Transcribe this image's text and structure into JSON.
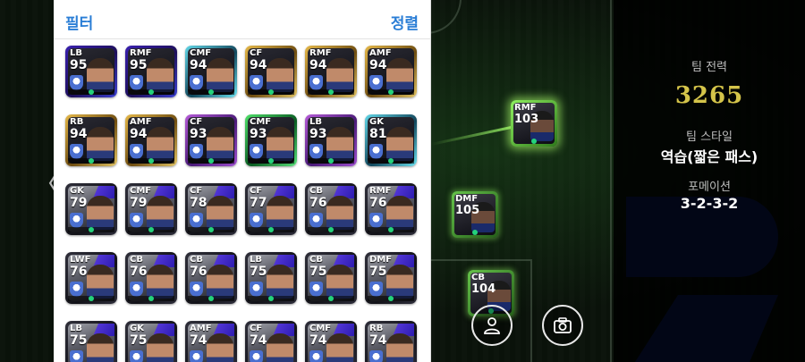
{
  "panel": {
    "filter_label": "필터",
    "sort_label": "정렬",
    "cards": [
      {
        "pos": "LB",
        "ovr": "95",
        "tier": "blue"
      },
      {
        "pos": "RMF",
        "ovr": "95",
        "tier": "blue"
      },
      {
        "pos": "CMF",
        "ovr": "94",
        "tier": "teal"
      },
      {
        "pos": "CF",
        "ovr": "94",
        "tier": "gold"
      },
      {
        "pos": "RMF",
        "ovr": "94",
        "tier": "gold"
      },
      {
        "pos": "AMF",
        "ovr": "94",
        "tier": "gold"
      },
      {
        "pos": "RB",
        "ovr": "94",
        "tier": "gold"
      },
      {
        "pos": "AMF",
        "ovr": "94",
        "tier": "gold"
      },
      {
        "pos": "CF",
        "ovr": "93",
        "tier": "purple"
      },
      {
        "pos": "CMF",
        "ovr": "93",
        "tier": "green"
      },
      {
        "pos": "LB",
        "ovr": "93",
        "tier": "purple"
      },
      {
        "pos": "GK",
        "ovr": "81",
        "tier": "teal"
      },
      {
        "pos": "GK",
        "ovr": "79",
        "tier": "dark"
      },
      {
        "pos": "CMF",
        "ovr": "79",
        "tier": "dark"
      },
      {
        "pos": "CF",
        "ovr": "78",
        "tier": "dark"
      },
      {
        "pos": "CF",
        "ovr": "77",
        "tier": "dark"
      },
      {
        "pos": "CB",
        "ovr": "76",
        "tier": "dark"
      },
      {
        "pos": "RMF",
        "ovr": "76",
        "tier": "dark"
      },
      {
        "pos": "LWF",
        "ovr": "76",
        "tier": "dark"
      },
      {
        "pos": "CB",
        "ovr": "76",
        "tier": "dark"
      },
      {
        "pos": "CB",
        "ovr": "76",
        "tier": "dark"
      },
      {
        "pos": "LB",
        "ovr": "75",
        "tier": "dark"
      },
      {
        "pos": "CB",
        "ovr": "75",
        "tier": "dark"
      },
      {
        "pos": "DMF",
        "ovr": "75",
        "tier": "dark"
      },
      {
        "pos": "LB",
        "ovr": "75",
        "tier": "dark"
      },
      {
        "pos": "GK",
        "ovr": "75",
        "tier": "dark"
      },
      {
        "pos": "AMF",
        "ovr": "74",
        "tier": "dark"
      },
      {
        "pos": "CF",
        "ovr": "74",
        "tier": "dark"
      },
      {
        "pos": "CMF",
        "ovr": "74",
        "tier": "dark"
      },
      {
        "pos": "RB",
        "ovr": "74",
        "tier": "dark"
      }
    ]
  },
  "pitch": {
    "rmf": {
      "pos": "RMF",
      "ovr": "103"
    },
    "dmf": {
      "pos": "DMF",
      "ovr": "105"
    },
    "cb": {
      "pos": "CB",
      "ovr": "104"
    }
  },
  "stats": {
    "strength_label": "팀 전력",
    "strength_value": "3265",
    "style_label": "팀 스타일",
    "style_value": "역습(짧은 패스)",
    "formation_label": "포메이션",
    "formation_value": "3-2-3-2"
  },
  "nav": {
    "chevron": "〈"
  },
  "colors": {
    "accent": "#2a7ed6",
    "strength": "#d4c44a",
    "highlight": "#8ef05f"
  },
  "icons": {
    "person": "person-icon",
    "camera": "camera-icon",
    "prev": "chevron-left-icon"
  }
}
